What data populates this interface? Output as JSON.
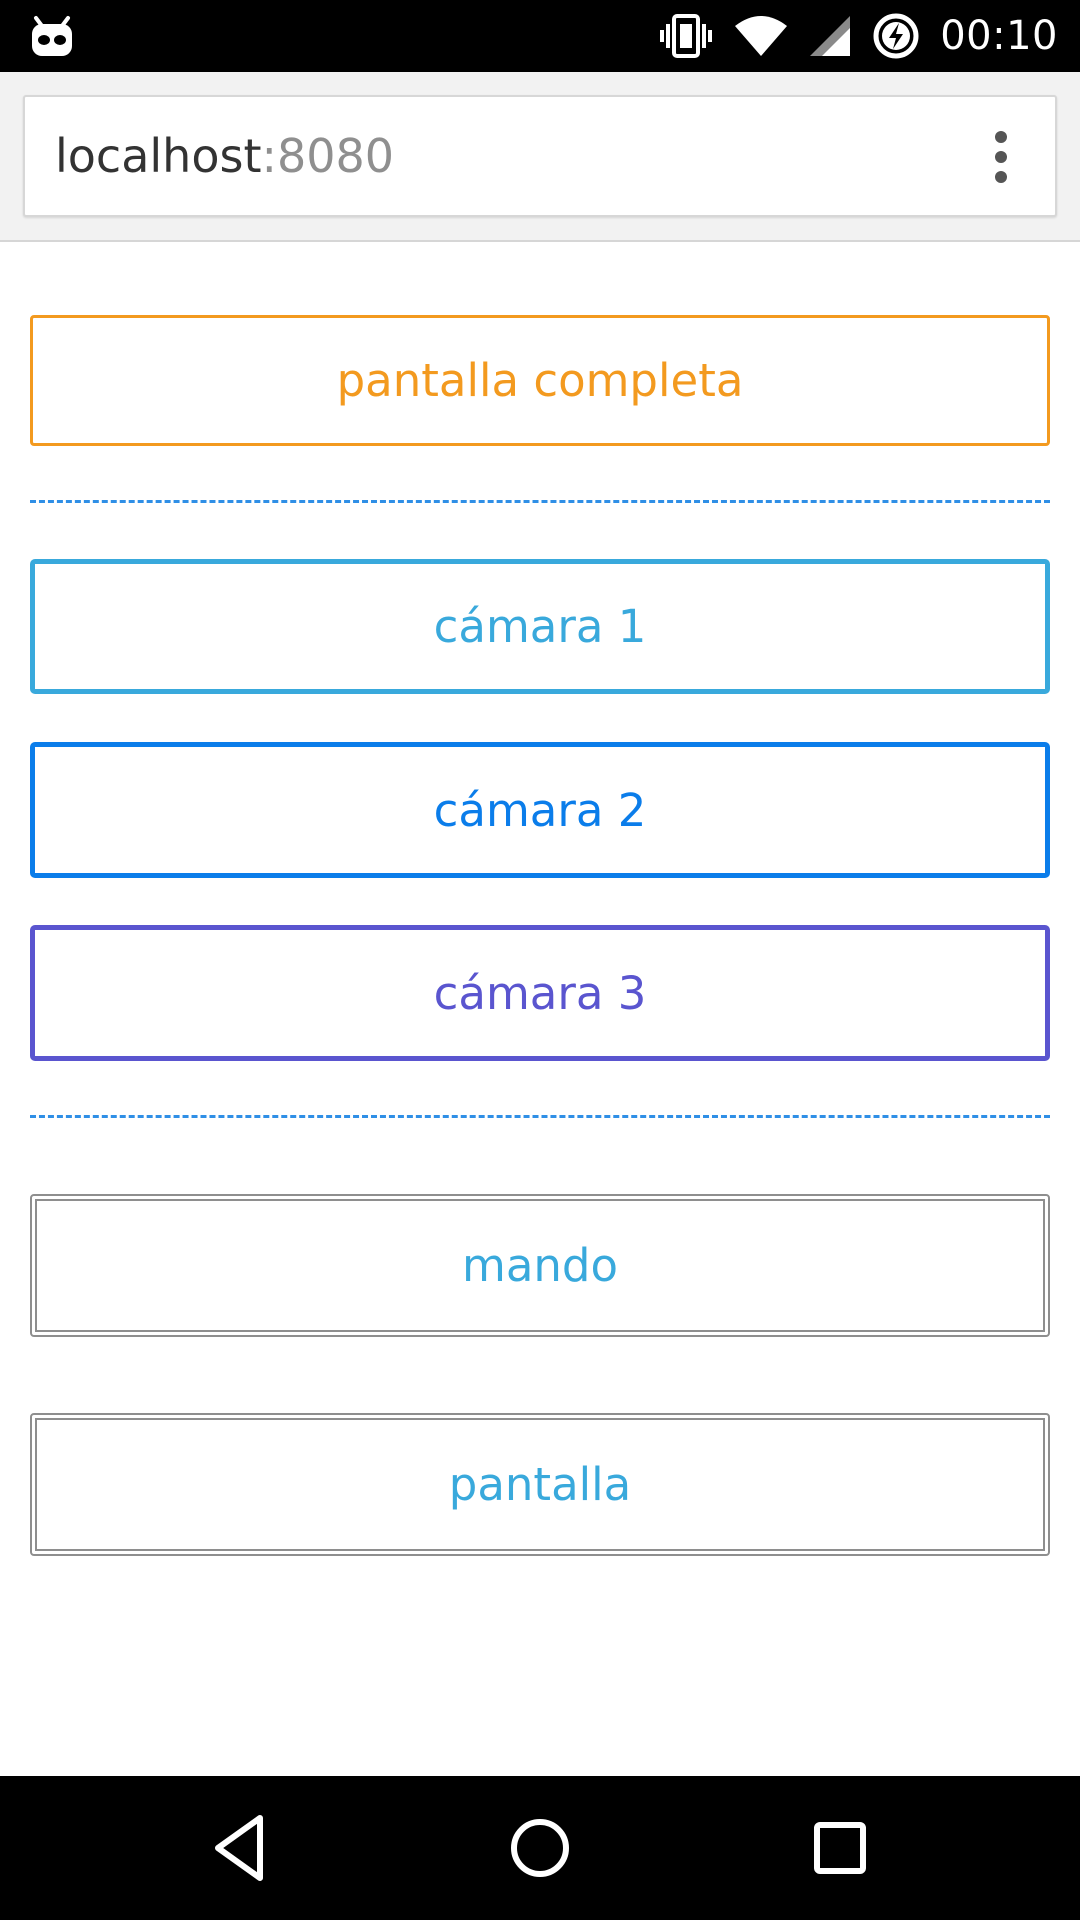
{
  "status_bar": {
    "time": "00:10",
    "left_icon": "cyanogen-android-icon",
    "icons": [
      "vibrate-icon",
      "wifi-icon",
      "signal-icon",
      "battery-charging-icon"
    ]
  },
  "browser": {
    "url_host": "localhost",
    "url_port": ":8080",
    "menu_icon": "overflow-menu-icon"
  },
  "buttons": {
    "fullscreen": "pantalla completa",
    "camera1": "cámara 1",
    "camera2": "cámara 2",
    "camera3": "cámara 3",
    "mando": "mando",
    "pantalla": "pantalla"
  },
  "colors": {
    "fullscreen": "#f39a1f",
    "camera1": "#39a9dc",
    "camera2": "#0b7dea",
    "camera3": "#5a55cf",
    "divider": "#2f8fe6",
    "double_border": "#8e8e8e"
  },
  "nav_bar": {
    "icons": [
      "back-icon",
      "home-icon",
      "recents-icon"
    ]
  }
}
